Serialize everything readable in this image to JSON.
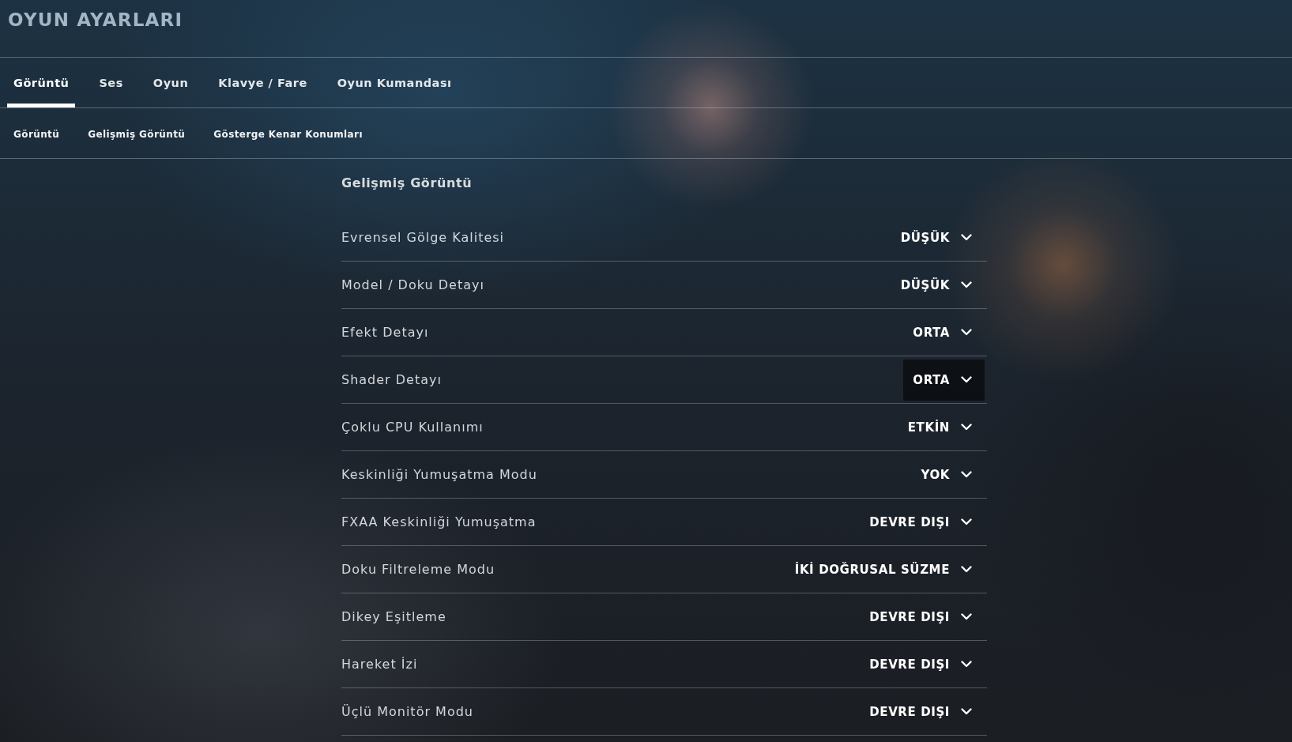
{
  "page_title": "OYUN AYARLARI",
  "tabs": [
    {
      "label": "Görüntü",
      "selected": true
    },
    {
      "label": "Ses",
      "selected": false
    },
    {
      "label": "Oyun",
      "selected": false
    },
    {
      "label": "Klavye / Fare",
      "selected": false
    },
    {
      "label": "Oyun Kumandası",
      "selected": false
    }
  ],
  "subtabs": [
    "Görüntü",
    "Gelişmiş Görüntü",
    "Gösterge Kenar Konumları"
  ],
  "section": {
    "title": "Gelişmiş Görüntü",
    "settings": [
      {
        "label": "Evrensel Gölge Kalitesi",
        "value": "DÜŞÜK",
        "highlighted": false
      },
      {
        "label": "Model / Doku Detayı",
        "value": "DÜŞÜK",
        "highlighted": false
      },
      {
        "label": "Efekt Detayı",
        "value": "ORTA",
        "highlighted": false
      },
      {
        "label": "Shader Detayı",
        "value": "ORTA",
        "highlighted": true
      },
      {
        "label": "Çoklu CPU Kullanımı",
        "value": "ETKİN",
        "highlighted": false
      },
      {
        "label": "Keskinliği Yumuşatma Modu",
        "value": "YOK",
        "highlighted": false
      },
      {
        "label": "FXAA Keskinliği Yumuşatma",
        "value": "DEVRE DIŞI",
        "highlighted": false
      },
      {
        "label": "Doku Filtreleme Modu",
        "value": "İKİ DOĞRUSAL SÜZME",
        "highlighted": false
      },
      {
        "label": "Dikey Eşitleme",
        "value": "DEVRE DIŞI",
        "highlighted": false
      },
      {
        "label": "Hareket İzi",
        "value": "DEVRE DIŞI",
        "highlighted": false
      },
      {
        "label": "Üçlü Monitör Modu",
        "value": "DEVRE DIŞI",
        "highlighted": false
      }
    ]
  }
}
